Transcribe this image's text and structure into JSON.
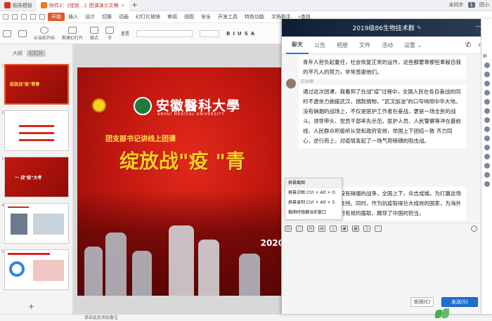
{
  "titlebar": {
    "tabs": [
      {
        "label": "稻壳模板",
        "close": ""
      },
      {
        "label": "附件2：《绽放...》团课演示文稿",
        "close": "×"
      }
    ],
    "new_tab": "+",
    "right": {
      "account": "未同步",
      "badge": "1",
      "user": "团小"
    }
  },
  "menubar": {
    "items": [
      "开始",
      "插入",
      "设计",
      "切换",
      "动画",
      "幻灯片放映",
      "审阅",
      "视图",
      "安全",
      "开发工具",
      "特色功能",
      "文档助手"
    ],
    "search": "查找"
  },
  "ribbon": {
    "play_label": "从当前开始",
    "new_slide_label": "新建幻灯片",
    "layout_label": "版式",
    "section_label": "节",
    "reset_label": "重置",
    "format_buttons": [
      "B",
      "I",
      "U",
      "S",
      "A"
    ]
  },
  "leftpanel": {
    "tabs": [
      "大纲",
      "幻灯片"
    ],
    "slides": [
      {
        "num": "1",
        "text": "绽放战\"疫\"青春"
      },
      {
        "num": "2",
        "text": "目录"
      },
      {
        "num": "3",
        "text": "一 战\"疫\"大考"
      },
      {
        "num": "4",
        "text": ""
      },
      {
        "num": "5",
        "text": ""
      },
      {
        "num": "6",
        "text": ""
      }
    ],
    "add": "+"
  },
  "slide": {
    "university_cn": "安徽醫科大學",
    "university_en": "ANHUI MEDICAL UNIVERSITY",
    "subtitle": "团支部书记讲线上团课",
    "headline": "绽放战\"疫 \"青",
    "year": "2020"
  },
  "statusbar": {
    "note": "单击此处添加备注"
  },
  "chat": {
    "title": "2019级86生物技术群",
    "tabs": [
      "聊天",
      "公告",
      "相册",
      "文件",
      "活动",
      "设置"
    ],
    "messages": [
      {
        "sender": "",
        "text": "青年人担负起重任，社会恢复正常的运作，这些都要靠那些奉献自我的平凡人的努力，非常感谢他们。"
      },
      {
        "sender": "石冰卿",
        "text": "通过这次团课，我看到了在战\"疫\"过程中，全国人民在各自奋战的同时不遗余力驰援武汉，捐款捐物，\"武汉加油\"的口号响彻中华大地。没有硝烟的战场上，不仅是医护工作者在奋战，更是一场全民的战斗。领导带头、党员干部率先示范，医护人员、人民警察等冲在最前线，人民群众积极听从党和政府安排，举国上下团结一致 齐力同心，逆行而上，对疫情发起了一场气势磅礴的阻击战。"
      },
      {
        "sender": "张丽",
        "text": "疫情防控是一场没有硝烟的战争，全国上下，众志成城，为打赢这场战役提供了有力支持。同时，作为抗疫取得巨大成效的国家，为海外的抗疫提供了及时有效的援助，展现了中国的担当。"
      }
    ],
    "context_menu": [
      "屏幕截图",
      "屏幕识图 Ctrl + Alt + O",
      "屏幕录制 Ctrl + Alt + S",
      "截图时隐藏当前窗口"
    ],
    "close_label": "关闭(C)",
    "send_label": "发送(S)"
  },
  "members": {
    "header": "群"
  }
}
